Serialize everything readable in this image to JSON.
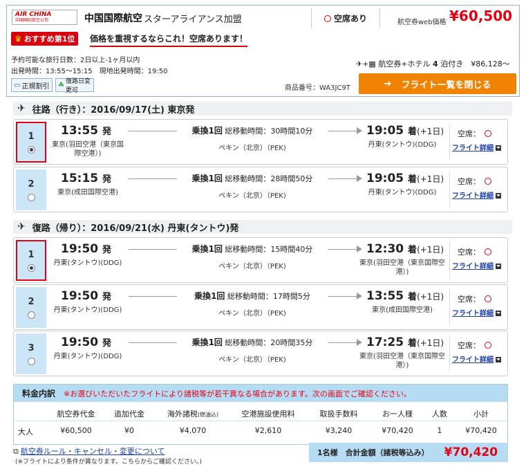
{
  "header": {
    "logo_main": "AIR CHINA",
    "logo_sub": "中国国际航空公司",
    "airline": "中国国際航空",
    "alliance": "スターアライアンス加盟",
    "seat_status": "空席あり",
    "price_label": "航空券web価格",
    "price": "¥60,500",
    "rank_badge": "おすすめ第1位",
    "catch_copy": "価格を重視するならこれ！空席あります！",
    "trip_days": "予約可能な旅行日数：2日以上-1ヶ月以内",
    "depart_time": "出発時間：13:55〜15:15　現地出発時間：19:50",
    "hotel_plan": "航空券+ホテル",
    "hotel_nights": "4",
    "hotel_nights_unit": "泊付き",
    "hotel_price": "¥86,128〜",
    "tag_regular": "正規割引",
    "tag_change": "復路日変更可",
    "product_code": "商品番号：WA3JC9T",
    "close_button": "フライト一覧を閉じる",
    "accent": "#e60012",
    "button_color": "#f08300"
  },
  "outbound": {
    "title": "往路（行き）：2016/09/17(土) 東京発",
    "flights": [
      {
        "no": "1",
        "selected": true,
        "dep": "13:55",
        "dep_suffix": "発",
        "dep_airport": "東京(羽田空港（東京国際空港）)",
        "transfer": "乗換1回",
        "duration": "総移動時間：30時間10分",
        "via": "ペキン（北京）（PEK)",
        "arr": "19:05",
        "arr_suffix": "着",
        "next": "(+1日)",
        "arr_airport": "丹東(タントウ)(DDG)",
        "avail": "空席：",
        "detail": "フライト詳細"
      },
      {
        "no": "2",
        "selected": false,
        "dep": "15:15",
        "dep_suffix": "発",
        "dep_airport": "東京(成田国際空港)",
        "transfer": "乗換1回",
        "duration": "総移動時間：28時間50分",
        "via": "ペキン（北京）（PEK)",
        "arr": "19:05",
        "arr_suffix": "着",
        "next": "(+1日)",
        "arr_airport": "丹東(タントウ)(DDG)",
        "avail": "空席：",
        "detail": "フライト詳細"
      }
    ]
  },
  "inbound": {
    "title": "復路（帰り）：2016/09/21(水) 丹東(タントウ)発",
    "flights": [
      {
        "no": "1",
        "selected": true,
        "dep": "19:50",
        "dep_suffix": "発",
        "dep_airport": "丹東(タントウ)(DDG)",
        "transfer": "乗換1回",
        "duration": "総移動時間：15時間40分",
        "via": "ペキン（北京）（PEK)",
        "arr": "12:30",
        "arr_suffix": "着",
        "next": "(+1日)",
        "arr_airport": "東京(羽田空港（東京国際空港）)",
        "avail": "空席：",
        "detail": "フライト詳細"
      },
      {
        "no": "2",
        "selected": false,
        "dep": "19:50",
        "dep_suffix": "発",
        "dep_airport": "丹東(タントウ)(DDG)",
        "transfer": "乗換1回",
        "duration": "総移動時間：17時間5分",
        "via": "ペキン（北京）（PEK)",
        "arr": "13:55",
        "arr_suffix": "着",
        "next": "(+1日)",
        "arr_airport": "東京(成田国際空港)",
        "avail": "空席：",
        "detail": "フライト詳細"
      },
      {
        "no": "3",
        "selected": false,
        "dep": "19:50",
        "dep_suffix": "発",
        "dep_airport": "丹東(タントウ)(DDG)",
        "transfer": "乗換1回",
        "duration": "総移動時間：20時間35分",
        "via": "ペキン（北京）（PEK)",
        "arr": "17:25",
        "arr_suffix": "着",
        "next": "(+1日)",
        "arr_airport": "東京(羽田空港（東京国際空港）)",
        "avail": "空席：",
        "detail": "フライト詳細"
      }
    ]
  },
  "fare": {
    "title": "料金内訳",
    "note": "※お選びいただいたフライトにより諸税等が若干異なる場合があります。次の画面でご確認ください。",
    "columns": [
      "航空券代金",
      "追加代金",
      "海外諸税",
      "(燃油込)",
      "空港施設使用料",
      "取扱手数料",
      "お一人様",
      "人数",
      "小計"
    ],
    "row_label": "大人",
    "row": [
      "¥60,500",
      "¥0",
      "¥4,070",
      "¥2,610",
      "¥3,240",
      "¥70,420",
      "1",
      "¥70,420"
    ],
    "total_label": "1名様　合計金額（諸税等込み）",
    "total": "¥70,420",
    "rule_link": "航空券ルール・キャンセル・変更について",
    "rule_note": "(※フライトにより条件が異なります。こちらからご確認ください。)"
  }
}
